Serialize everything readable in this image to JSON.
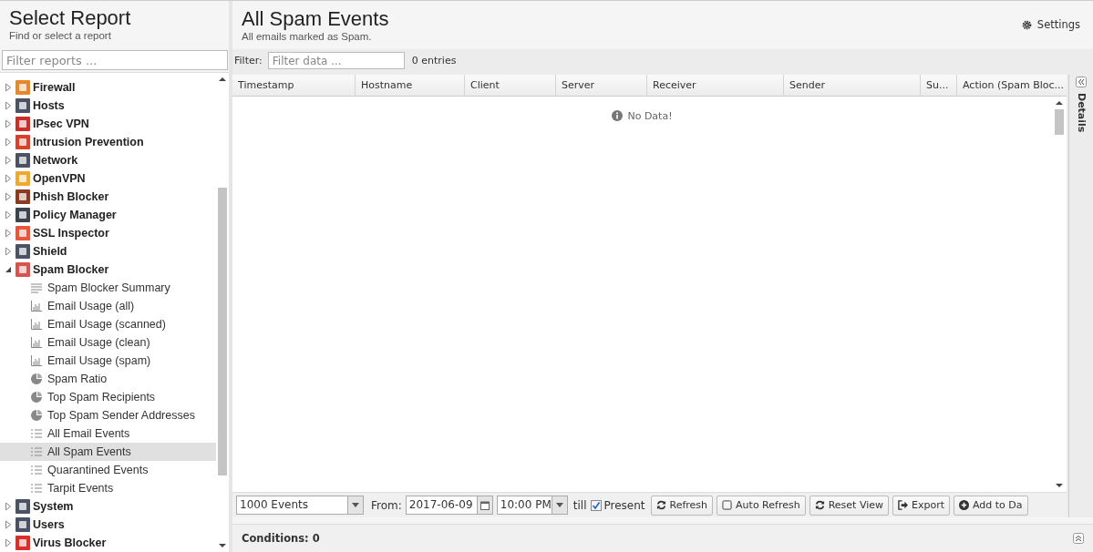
{
  "sidebar": {
    "title": "Select Report",
    "subtitle": "Find or select a report",
    "filter": {
      "placeholder": "Filter reports ..."
    },
    "tree": [
      {
        "label": "Firewall",
        "color": "#e8862a",
        "expanded": false
      },
      {
        "label": "Hosts",
        "color": "#4b5263",
        "expanded": false
      },
      {
        "label": "IPsec VPN",
        "color": "#c9302c",
        "expanded": false
      },
      {
        "label": "Intrusion Prevention",
        "color": "#d9412b",
        "expanded": false
      },
      {
        "label": "Network",
        "color": "#4b5263",
        "expanded": false
      },
      {
        "label": "OpenVPN",
        "color": "#f0a830",
        "expanded": false
      },
      {
        "label": "Phish Blocker",
        "color": "#8a3b22",
        "expanded": false
      },
      {
        "label": "Policy Manager",
        "color": "#3d4451",
        "expanded": false
      },
      {
        "label": "SSL Inspector",
        "color": "#e8553a",
        "expanded": false
      },
      {
        "label": "Shield",
        "color": "#4b5263",
        "expanded": false
      },
      {
        "label": "Spam Blocker",
        "color": "#d9534f",
        "expanded": true,
        "children": [
          {
            "label": "Spam Blocker Summary",
            "kind": "summary",
            "selected": false
          },
          {
            "label": "Email Usage (all)",
            "kind": "bar",
            "selected": false
          },
          {
            "label": "Email Usage (scanned)",
            "kind": "bar",
            "selected": false
          },
          {
            "label": "Email Usage (clean)",
            "kind": "bar",
            "selected": false
          },
          {
            "label": "Email Usage (spam)",
            "kind": "bar",
            "selected": false
          },
          {
            "label": "Spam Ratio",
            "kind": "pie",
            "selected": false
          },
          {
            "label": "Top Spam Recipients",
            "kind": "pie",
            "selected": false
          },
          {
            "label": "Top Spam Sender Addresses",
            "kind": "pie",
            "selected": false
          },
          {
            "label": "All Email Events",
            "kind": "list",
            "selected": false
          },
          {
            "label": "All Spam Events",
            "kind": "list",
            "selected": true
          },
          {
            "label": "Quarantined Events",
            "kind": "list",
            "selected": false
          },
          {
            "label": "Tarpit Events",
            "kind": "list",
            "selected": false
          }
        ]
      },
      {
        "label": "System",
        "color": "#4b5263",
        "expanded": false
      },
      {
        "label": "Users",
        "color": "#4b5263",
        "expanded": false
      },
      {
        "label": "Virus Blocker",
        "color": "#d9302c",
        "expanded": false
      }
    ]
  },
  "report": {
    "title": "All Spam Events",
    "subtitle": "All emails marked as Spam.",
    "settings": "Settings"
  },
  "filter": {
    "label": "Filter:",
    "placeholder": "Filter data ...",
    "entries": "0 entries"
  },
  "table": {
    "columns": [
      "Timestamp",
      "Hostname",
      "Client",
      "Server",
      "Receiver",
      "Sender",
      "Su...",
      "Action (Spam Bloc..."
    ],
    "empty": "No Data!"
  },
  "details": "Details",
  "toolbar": {
    "limit": "1000 Events",
    "from_label": "From:",
    "date": "2017-06-09",
    "time": "10:00 PM",
    "till_label": "till",
    "present": {
      "label": "Present",
      "checked": true
    },
    "buttons": [
      {
        "label": "Refresh",
        "kind": "refresh"
      },
      {
        "label": "Auto Refresh",
        "kind": "check"
      },
      {
        "label": "Reset View",
        "kind": "refresh"
      },
      {
        "label": "Export",
        "kind": "export"
      },
      {
        "label": "Add to Da",
        "kind": "add"
      }
    ]
  },
  "conditions": "Conditions: 0"
}
